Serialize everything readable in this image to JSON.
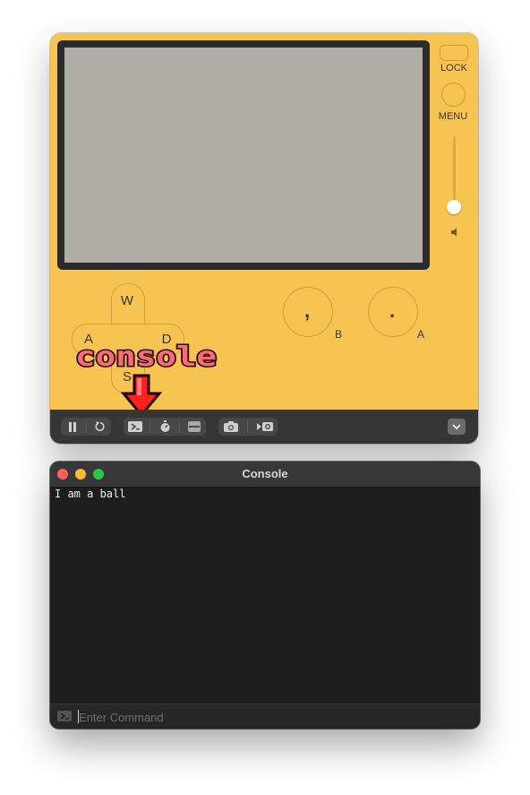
{
  "device": {
    "lock_label": "LOCK",
    "menu_label": "MENU",
    "volume_level": 1.0,
    "dpad": {
      "up": "W",
      "left": "A",
      "right": "D",
      "down": "S"
    },
    "buttons": {
      "b": {
        "glyph": ",",
        "letter": "B"
      },
      "a": {
        "glyph": ".",
        "letter": "A"
      }
    },
    "annotation": {
      "text": "console"
    },
    "toolbar": {
      "icons": [
        "pause-icon",
        "restart-icon",
        "console-icon",
        "stopwatch-icon",
        "device-icon",
        "camera-icon",
        "record-icon",
        "chevron-down-icon"
      ]
    },
    "colors": {
      "body": "#f8c451",
      "screen": "#b1aea8",
      "toolbar": "#363636",
      "annotation_fill": "#ff6a78",
      "arrow": "#ff2020"
    }
  },
  "console": {
    "title": "Console",
    "output": "I am a ball",
    "input": {
      "placeholder": "Enter Command",
      "value": ""
    },
    "colors": {
      "close": "#fe5f57",
      "minimize": "#febc2e",
      "maximize": "#28c840",
      "background": "#1e1e1e"
    }
  }
}
